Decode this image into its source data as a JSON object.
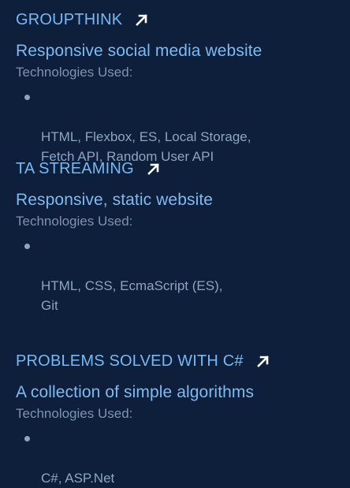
{
  "projects": [
    {
      "title": "GROUPTHINK",
      "description": "Responsive social media website",
      "tech_label": "Technologies Used:",
      "tech_items": [
        "HTML, Flexbox, ES, Local Storage,\nFetch API, Random User API"
      ]
    },
    {
      "title": "TA STREAMING",
      "description": "Responsive, static website",
      "tech_label": "Technologies Used:",
      "tech_items": [
        "HTML, CSS, EcmaScript (ES),\nGit"
      ]
    },
    {
      "title": "PROBLEMS SOLVED WITH C#",
      "description": "A collection of simple algorithms",
      "tech_label": "Technologies Used:",
      "tech_items": [
        "C#, ASP.Net"
      ]
    }
  ],
  "colors": {
    "background": "#0d1f3a",
    "title": "#76b9f4",
    "description": "#7fbaf0",
    "muted": "#7d93b0"
  },
  "icons": {
    "link": "arrow-up-right-icon"
  }
}
